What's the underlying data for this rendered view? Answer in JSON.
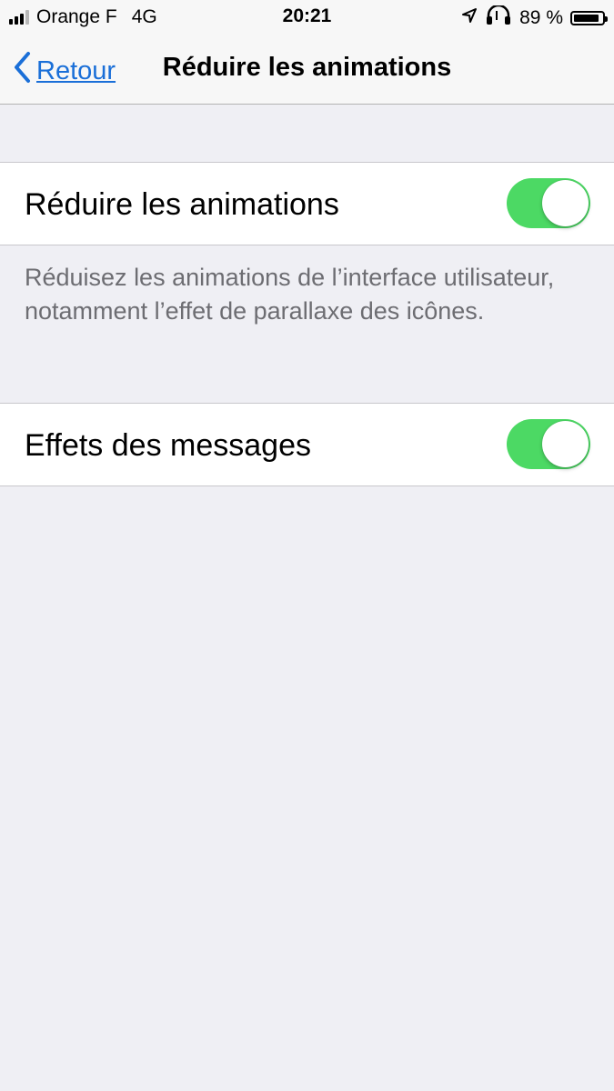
{
  "status_bar": {
    "carrier": "Orange F",
    "network": "4G",
    "time": "20:21",
    "battery": "89 %",
    "battery_level": 0.89
  },
  "nav": {
    "back_label": "Retour",
    "title": "Réduire les animations"
  },
  "settings": {
    "reduce_motion": {
      "label": "Réduire les animations",
      "enabled": true
    },
    "reduce_motion_footer": "Réduisez les animations de l’interface utilisateur, notamment l’effet de parallaxe des icônes.",
    "message_effects": {
      "label": "Effets des messages",
      "enabled": true
    }
  },
  "colors": {
    "accent": "#1a6fd8",
    "toggle_on": "#4cd964",
    "background": "#efeff4"
  }
}
